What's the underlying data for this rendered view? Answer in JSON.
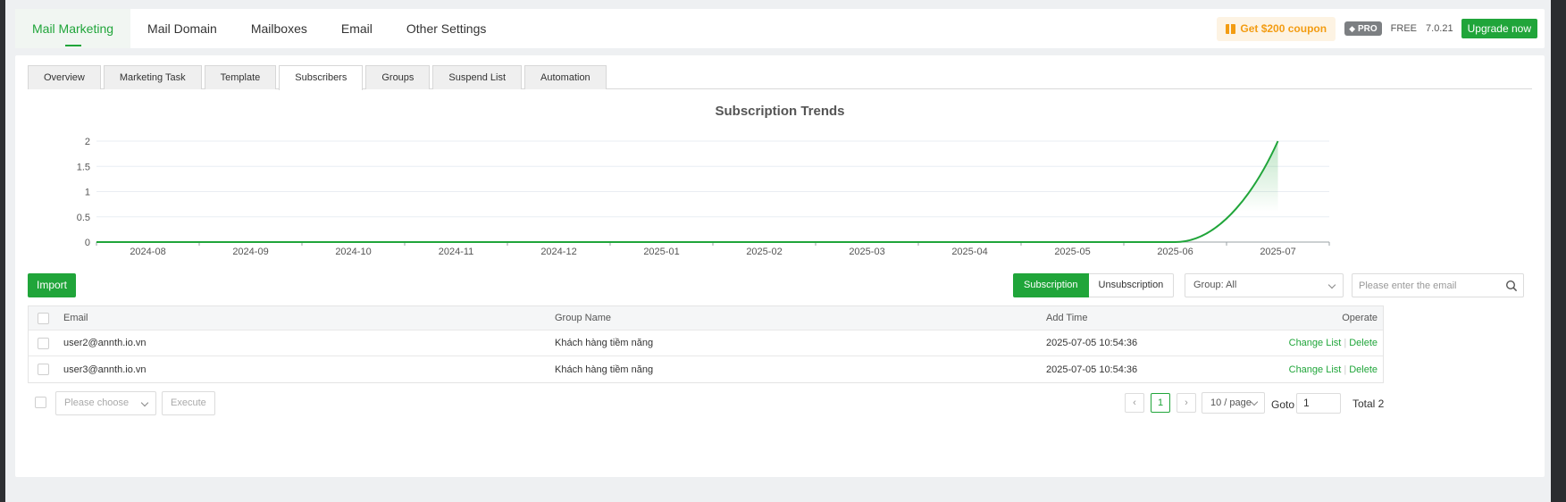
{
  "topnav": {
    "tabs": [
      {
        "label": "Mail Marketing"
      },
      {
        "label": "Mail Domain"
      },
      {
        "label": "Mailboxes"
      },
      {
        "label": "Email"
      },
      {
        "label": "Other Settings"
      }
    ],
    "coupon_label": "Get $200 coupon",
    "pro_label": "PRO",
    "free_label": "FREE",
    "version": "7.0.21",
    "upgrade_label": "Upgrade now"
  },
  "subtabs": [
    {
      "label": "Overview"
    },
    {
      "label": "Marketing Task"
    },
    {
      "label": "Template"
    },
    {
      "label": "Subscribers"
    },
    {
      "label": "Groups"
    },
    {
      "label": "Suspend List"
    },
    {
      "label": "Automation"
    }
  ],
  "chart_data": {
    "type": "area",
    "title": "Subscription Trends",
    "xlabel": "",
    "ylabel": "",
    "categories": [
      "2024-08",
      "2024-09",
      "2024-10",
      "2024-11",
      "2024-12",
      "2025-01",
      "2025-02",
      "2025-03",
      "2025-04",
      "2025-05",
      "2025-06",
      "2025-07"
    ],
    "values": [
      0,
      0,
      0,
      0,
      0,
      0,
      0,
      0,
      0,
      0,
      0,
      2
    ],
    "yticks": [
      "0",
      "0.5",
      "1",
      "1.5",
      "2"
    ],
    "ylim": [
      0,
      2
    ],
    "grid": true,
    "line_color": "#20a53a"
  },
  "toolbar": {
    "import_label": "Import",
    "subscription_label": "Subscription",
    "unsubscription_label": "Unsubscription",
    "group_select_value": "Group: All",
    "search_placeholder": "Please enter the email"
  },
  "table": {
    "headers": {
      "email": "Email",
      "group": "Group Name",
      "time": "Add Time",
      "operate": "Operate"
    },
    "rows": [
      {
        "email": "user2@annth.io.vn",
        "group": "Khách hàng tiềm năng",
        "time": "2025-07-05 10:54:36",
        "change": "Change List",
        "delete": "Delete"
      },
      {
        "email": "user3@annth.io.vn",
        "group": "Khách hàng tiềm năng",
        "time": "2025-07-05 10:54:36",
        "change": "Change List",
        "delete": "Delete"
      }
    ]
  },
  "footer": {
    "batch_placeholder": "Please choose",
    "execute_label": "Execute",
    "prev_icon": "‹",
    "next_icon": "›",
    "current_page": "1",
    "per_page": "10 / page",
    "goto_label": "Goto",
    "goto_value": "1",
    "total_label": "Total 2"
  }
}
